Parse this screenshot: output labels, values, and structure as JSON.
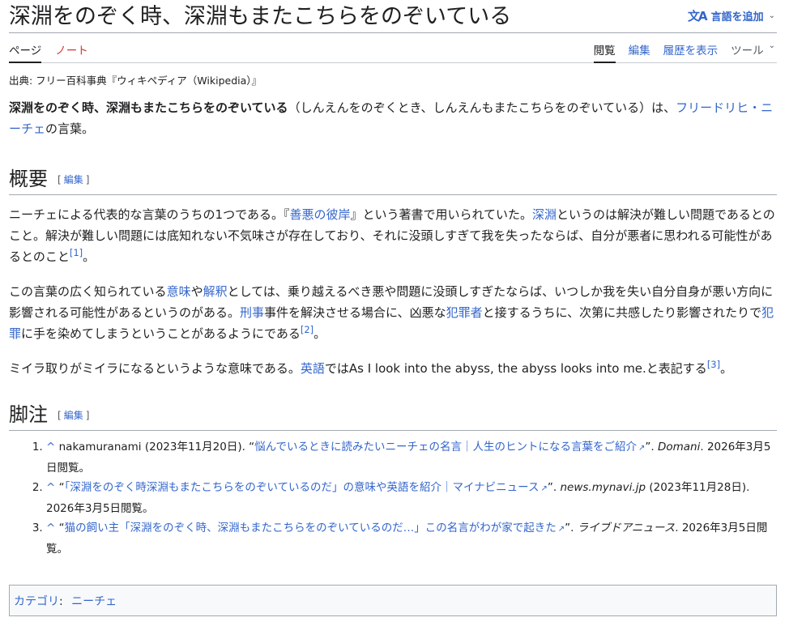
{
  "header": {
    "title": "深淵をのぞく時、深淵もまたこちらをのぞいている",
    "lang_icon": "文A",
    "lang_label": "言語を追加"
  },
  "tabs": {
    "page": "ページ",
    "talk": "ノート",
    "read": "閲覧",
    "edit": "編集",
    "history": "履歴を表示",
    "tools": "ツール"
  },
  "subtitle": "出典: フリー百科事典『ウィキペディア（Wikipedia）』",
  "lead": {
    "bold": "深淵をのぞく時、深淵もまたこちらをのぞいている",
    "text1": "（しんえんをのぞくとき、しんえんもまたこちらをのぞいている）は、",
    "link": "フリードリヒ・ニーチェ",
    "text2": "の言葉。"
  },
  "summary": {
    "heading": "概要",
    "edit_label": "編集",
    "p1": {
      "t1": "ニーチェによる代表的な言葉のうちの1つである。『",
      "l1": "善悪の彼岸",
      "t2": "』という著書で用いられていた。",
      "l2": "深淵",
      "t3": "というのは解決が難しい問題であるとのこと。解決が難しい問題には底知れない不気味さが存在しており、それに没頭しすぎて我を失ったならば、自分が悪者に思われる可能性があるとのこと",
      "ref": "[1]",
      "t4": "。"
    },
    "p2": {
      "t1": "この言葉の広く知られている",
      "l1": "意味",
      "t2": "や",
      "l2": "解釈",
      "t3": "としては、乗り越えるべき悪や問題に没頭しすぎたならば、いつしか我を失い自分自身が悪い方向に影響される可能性があるというのがある。",
      "l3": "刑事",
      "t4": "事件を解決させる場合に、凶悪な",
      "l4": "犯罪者",
      "t5": "と接するうちに、次第に共感したり影響されたりで",
      "l5": "犯罪",
      "t6": "に手を染めてしまうということがあるようにである",
      "ref": "[2]",
      "t7": "。"
    },
    "p3": {
      "t1": "ミイラ取りがミイラになるというような意味である。",
      "l1": "英語",
      "t2": "ではAs I look into the abyss, the abyss looks into me.と表記する",
      "ref": "[3]",
      "t3": "。"
    }
  },
  "notes": {
    "heading": "脚注",
    "edit_label": "編集",
    "refs": [
      {
        "caret": "^",
        "pre": "nakamuranami (2023年11月20日). “",
        "link": "悩んでいるときに読みたいニーチェの名言｜人生のヒントになる言葉をご紹介",
        "mid": "”. ",
        "site": "Domani",
        "post": ". 2026年3月5日閲覧。"
      },
      {
        "caret": "^",
        "pre": "“",
        "link": "「深淵をのぞく時深淵もまたこちらをのぞいているのだ」の意味や英語を紹介｜マイナビニュース",
        "mid": "”. ",
        "site": "news.mynavi.jp",
        "post": " (2023年11月28日). 2026年3月5日閲覧。"
      },
      {
        "caret": "^",
        "pre": "“",
        "link": "猫の飼い主「深淵をのぞく時、深淵もまたこちらをのぞいているのだ…」この名言がわが家で起きた",
        "mid": "”. ",
        "site": "ライブドアニュース",
        "post": ". 2026年3月5日閲覧。"
      }
    ]
  },
  "categories": {
    "label": "カテゴリ",
    "items": [
      "ニーチェ"
    ]
  }
}
